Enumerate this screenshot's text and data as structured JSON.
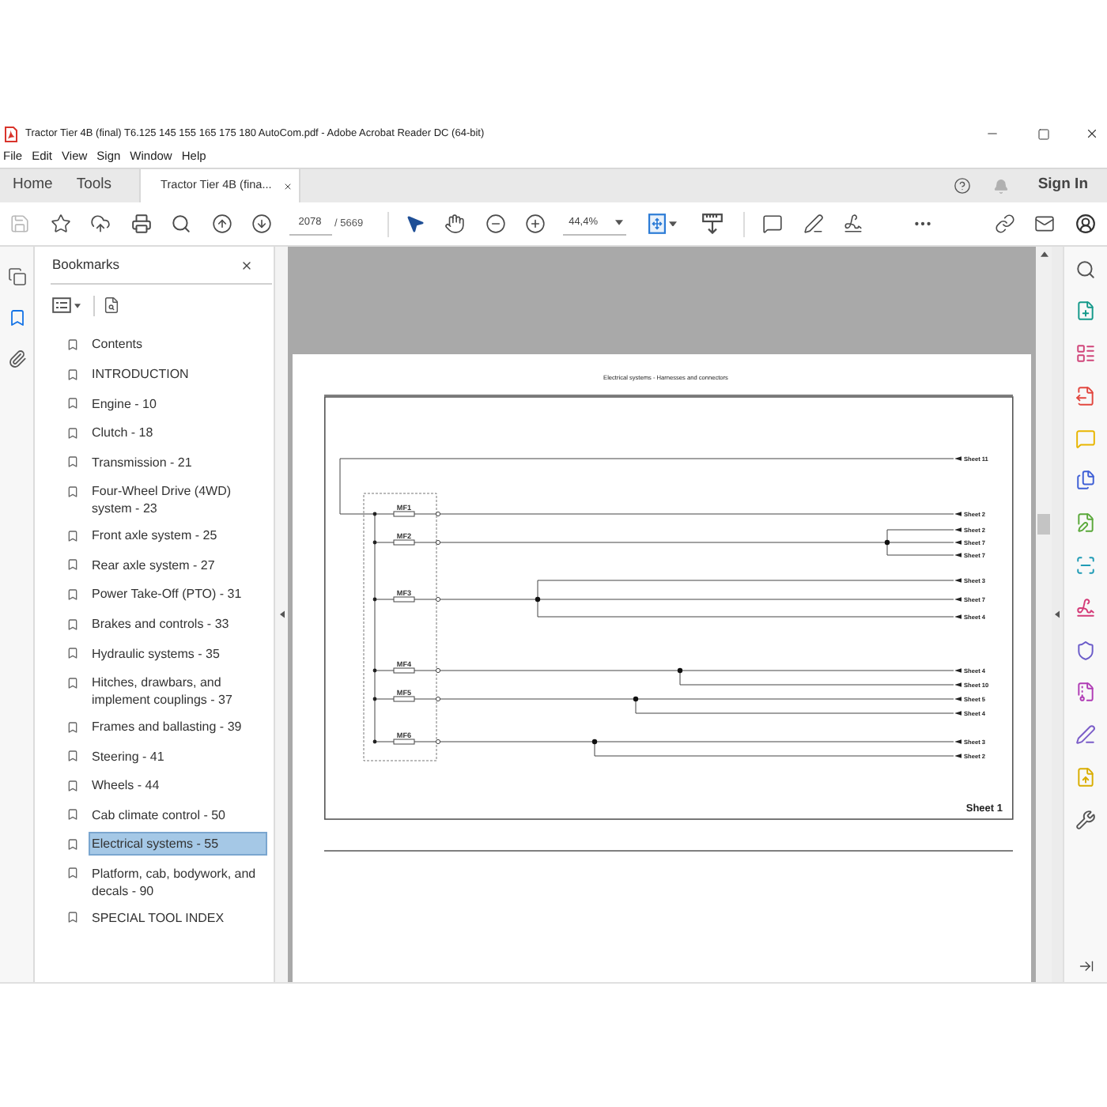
{
  "window": {
    "title": "Tractor Tier 4B (final) T6.125 145 155 165 175 180 AutoCom.pdf - Adobe Acrobat Reader DC (64-bit)"
  },
  "menu": [
    "File",
    "Edit",
    "View",
    "Sign",
    "Window",
    "Help"
  ],
  "tabs": [
    {
      "label": "Home",
      "kind": "nav",
      "selected": false
    },
    {
      "label": "Tools",
      "kind": "nav",
      "selected": false
    },
    {
      "label": "Tractor Tier 4B (fina...",
      "kind": "document",
      "selected": true
    }
  ],
  "account": {
    "sign_in": "Sign In"
  },
  "toolbar": {
    "save": {
      "disabled": true
    },
    "page_number": "2078",
    "page_count": "/ 5669",
    "zoom": "44,4%"
  },
  "nav_rail": [
    {
      "kind": "pages",
      "selected": false
    },
    {
      "kind": "bookmarks",
      "selected": true
    },
    {
      "kind": "attachments",
      "selected": false
    }
  ],
  "bookmarks": {
    "title": "Bookmarks",
    "items": [
      {
        "label": "Contents",
        "selected": false
      },
      {
        "label": "INTRODUCTION",
        "selected": false
      },
      {
        "label": "Engine - 10",
        "selected": false
      },
      {
        "label": "Clutch - 18",
        "selected": false
      },
      {
        "label": "Transmission - 21",
        "selected": false
      },
      {
        "label": "Four-Wheel Drive (4WD) system - 23",
        "selected": false
      },
      {
        "label": "Front axle system - 25",
        "selected": false
      },
      {
        "label": "Rear axle system - 27",
        "selected": false
      },
      {
        "label": "Power Take-Off (PTO) - 31",
        "selected": false
      },
      {
        "label": "Brakes and controls - 33",
        "selected": false
      },
      {
        "label": "Hydraulic systems - 35",
        "selected": false
      },
      {
        "label": "Hitches, drawbars, and implement couplings - 37",
        "selected": false
      },
      {
        "label": "Frames and ballasting - 39",
        "selected": false
      },
      {
        "label": "Steering - 41",
        "selected": false
      },
      {
        "label": "Wheels - 44",
        "selected": false
      },
      {
        "label": "Cab climate control - 50",
        "selected": false
      },
      {
        "label": "Electrical systems - 55",
        "selected": true
      },
      {
        "label": "Platform, cab, bodywork, and decals - 90",
        "selected": false
      },
      {
        "label": "SPECIAL TOOL INDEX",
        "selected": false
      }
    ]
  },
  "document": {
    "header": "Electrical systems - Harnesses and connectors",
    "fuses": [
      "MF1",
      "MF2",
      "MF3",
      "MF4",
      "MF5",
      "MF6"
    ],
    "sheet_refs": [
      "Sheet 11",
      "Sheet 2",
      "Sheet 2",
      "Sheet 7",
      "Sheet 7",
      "Sheet 3",
      "Sheet 7",
      "Sheet 4",
      "Sheet 4",
      "Sheet 10",
      "Sheet 5",
      "Sheet 4",
      "Sheet 3",
      "Sheet 2"
    ],
    "sheet_label": "Sheet 1"
  }
}
